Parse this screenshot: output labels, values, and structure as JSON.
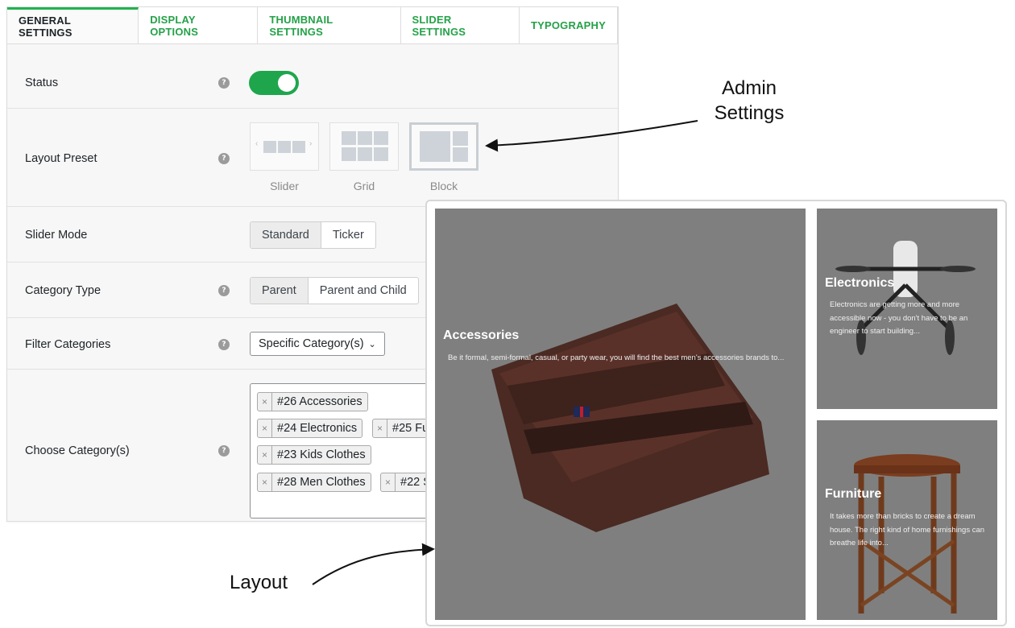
{
  "tabs": [
    {
      "label": "GENERAL SETTINGS"
    },
    {
      "label": "DISPLAY OPTIONS"
    },
    {
      "label": "THUMBNAIL SETTINGS"
    },
    {
      "label": "SLIDER SETTINGS"
    },
    {
      "label": "TYPOGRAPHY"
    }
  ],
  "settings": {
    "status": {
      "label": "Status",
      "enabled": true
    },
    "layout_preset": {
      "label": "Layout Preset",
      "options": [
        "Slider",
        "Grid",
        "Block"
      ],
      "selected": "Block"
    },
    "slider_mode": {
      "label": "Slider Mode",
      "options": [
        "Standard",
        "Ticker"
      ],
      "selected": "Standard"
    },
    "category_type": {
      "label": "Category Type",
      "options": [
        "Parent",
        "Parent and Child"
      ],
      "selected": "Parent"
    },
    "filter_categories": {
      "label": "Filter Categories",
      "value": "Specific Category(s)"
    },
    "choose_category": {
      "label": "Choose Category(s)",
      "chips": [
        "#26 Accessories",
        "#24 Electronics",
        "#25 Fu",
        "#23 Kids Clothes",
        "#28 Men Clothes",
        "#22 S"
      ]
    }
  },
  "preview": {
    "cards": [
      {
        "title": "Accessories",
        "desc": "Be it formal, semi-formal, casual, or party wear, you will find the best men's accessories brands to..."
      },
      {
        "title": "Electronics",
        "desc": "Electronics are getting more and more accessible now - you don't have to be an engineer to start building..."
      },
      {
        "title": "Furniture",
        "desc": "It takes more than bricks to create a dream house. The right kind of home furnishings can breathe life into..."
      }
    ]
  },
  "annotations": {
    "admin": "Admin\nSettings",
    "layout": "Layout"
  },
  "colors": {
    "accent": "#24a148",
    "toggle_on": "#1fa64d",
    "card_bg": "#7f7f7f"
  },
  "icons": {
    "help": "question-circle-icon",
    "remove": "close-icon",
    "dropdown": "chevron-down-icon"
  }
}
